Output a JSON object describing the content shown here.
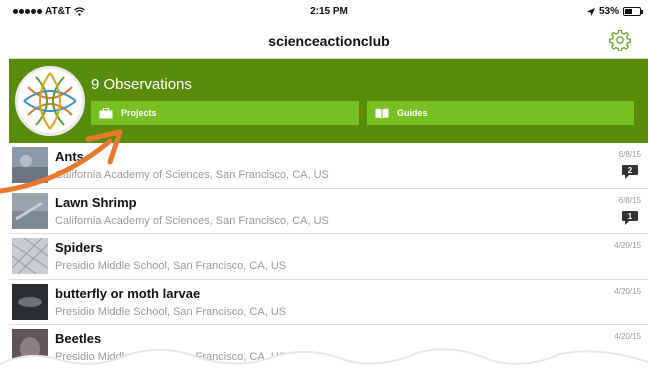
{
  "status_bar": {
    "carrier": "AT&T",
    "time": "2:15 PM",
    "battery_percent": "53%",
    "battery_level": 0.53
  },
  "nav": {
    "title": "scienceactionclub",
    "settings_icon": "gear-icon"
  },
  "banner": {
    "observations": "9 Observations",
    "projects_label": "Projects",
    "guides_label": "Guides",
    "colors": {
      "banner": "#5a8c0c",
      "button": "#77bf23"
    }
  },
  "observations": [
    {
      "name": "Ants",
      "location": "California Academy of Sciences, San Francisco, CA, US",
      "date": "6/8/15",
      "comments": "2"
    },
    {
      "name": "Lawn Shrimp",
      "location": "California Academy of Sciences, San Francisco, CA, US",
      "date": "6/8/15",
      "comments": "1"
    },
    {
      "name": "Spiders",
      "location": "Presidio Middle School, San Francisco, CA, US",
      "date": "4/20/15"
    },
    {
      "name": "butterfly or moth larvae",
      "location": "Presidio Middle School, San Francisco, CA, US",
      "date": "4/20/15"
    },
    {
      "name": "Beetles",
      "location": "Presidio Middle School, San Francisco, CA, US",
      "date": "4/20/15"
    }
  ],
  "annotation": {
    "arrow_color": "#e8782b"
  }
}
